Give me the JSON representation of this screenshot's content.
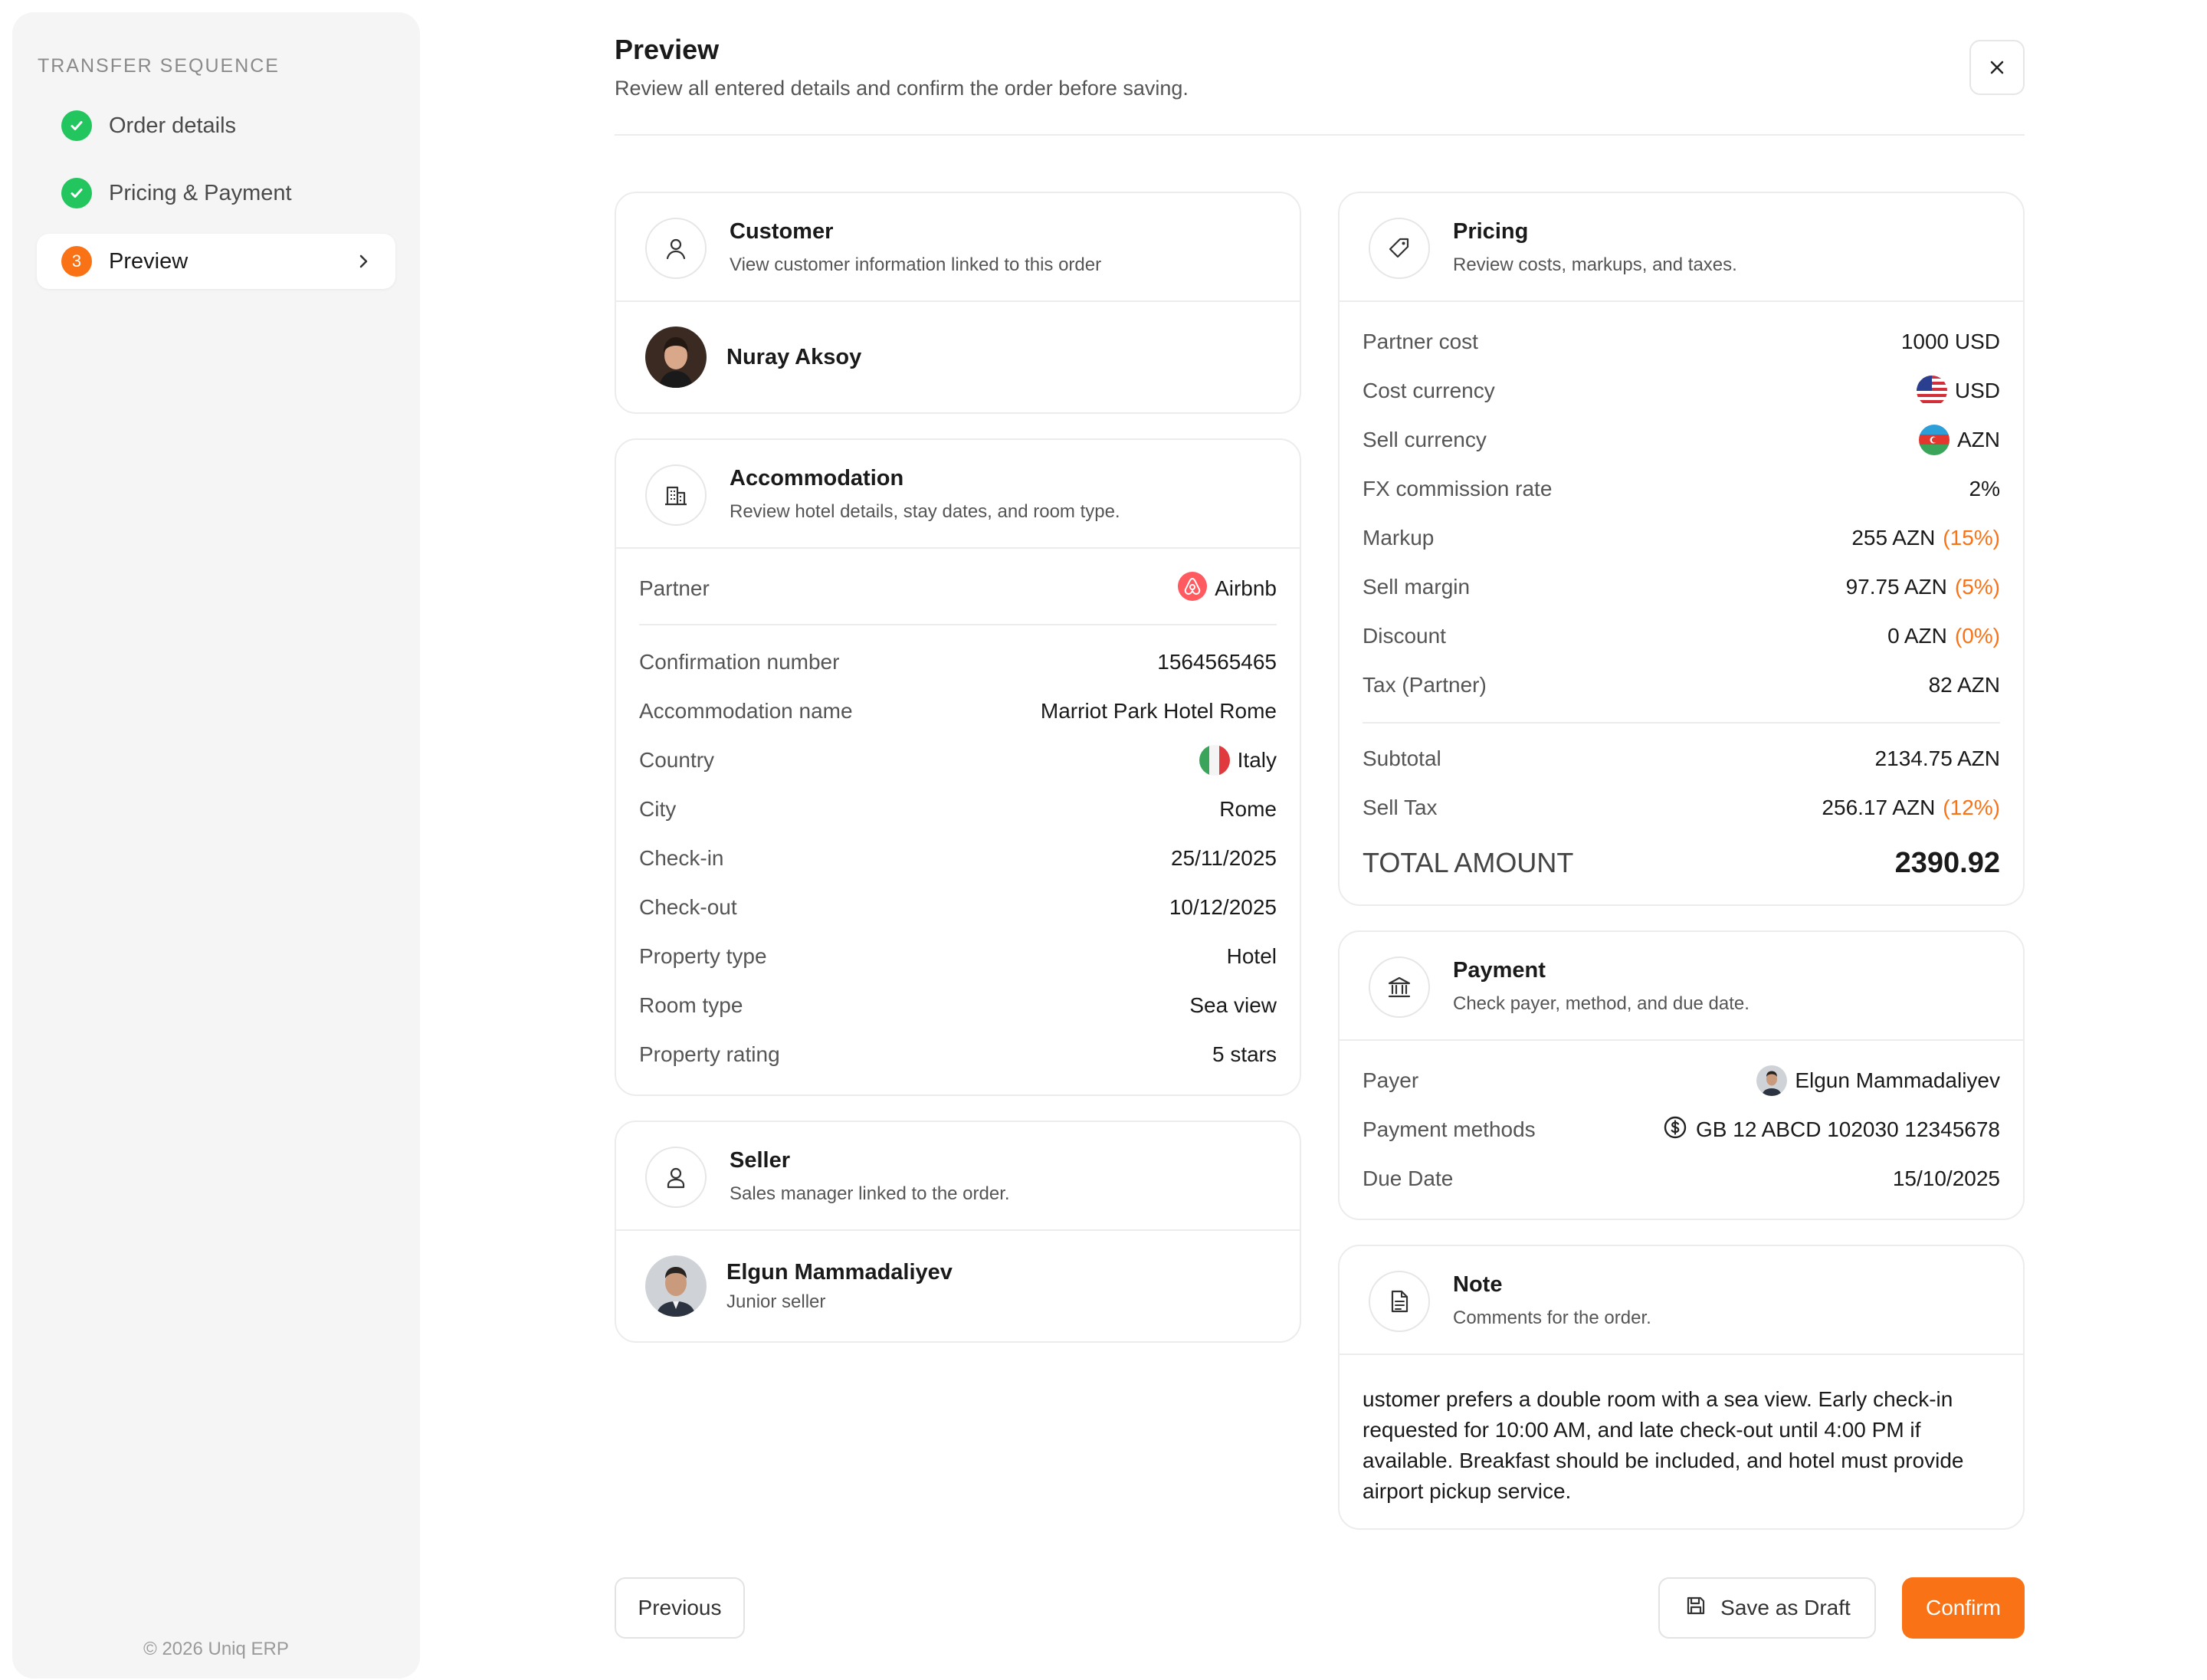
{
  "sidebar": {
    "title": "TRANSFER SEQUENCE",
    "steps": [
      {
        "label": "Order details",
        "state": "done"
      },
      {
        "label": "Pricing & Payment",
        "state": "done"
      },
      {
        "label": "Preview",
        "state": "current",
        "number": "3"
      }
    ],
    "copyright": "© 2026 Uniq ERP"
  },
  "header": {
    "title": "Preview",
    "subtitle": "Review all entered details and confirm the order before saving."
  },
  "customer": {
    "title": "Customer",
    "subtitle": "View customer information linked to this order",
    "name": "Nuray Aksoy"
  },
  "accommodation": {
    "title": "Accommodation",
    "subtitle": "Review hotel details, stay dates, and room type.",
    "partner_label": "Partner",
    "partner_value": "Airbnb",
    "rows": [
      {
        "label": "Confirmation number",
        "value": "1564565465"
      },
      {
        "label": "Accommodation name",
        "value": "Marriot Park Hotel Rome"
      },
      {
        "label": "Country",
        "value": "Italy"
      },
      {
        "label": "City",
        "value": "Rome"
      },
      {
        "label": "Check-in",
        "value": "25/11/2025"
      },
      {
        "label": "Check-out",
        "value": "10/12/2025"
      },
      {
        "label": "Property type",
        "value": "Hotel"
      },
      {
        "label": "Room type",
        "value": "Sea view"
      },
      {
        "label": "Property rating",
        "value": "5 stars"
      }
    ]
  },
  "seller": {
    "title": "Seller",
    "subtitle": "Sales manager linked to the order.",
    "name": "Elgun Mammadaliyev",
    "role": "Junior seller"
  },
  "pricing": {
    "title": "Pricing",
    "subtitle": "Review costs, markups, and taxes.",
    "rows": [
      {
        "label": "Partner cost",
        "value": "1000 USD",
        "extra": ""
      },
      {
        "label": "Cost currency",
        "value": "USD",
        "extra": ""
      },
      {
        "label": "Sell currency",
        "value": "AZN",
        "extra": ""
      },
      {
        "label": "FX commission rate",
        "value": "2%",
        "extra": ""
      },
      {
        "label": "Markup",
        "value": "255 AZN",
        "extra": "(15%)"
      },
      {
        "label": "Sell margin",
        "value": "97.75 AZN",
        "extra": "(5%)"
      },
      {
        "label": "Discount",
        "value": "0 AZN",
        "extra": "(0%)"
      },
      {
        "label": "Tax (Partner)",
        "value": "82 AZN",
        "extra": ""
      }
    ],
    "subtotal_label": "Subtotal",
    "subtotal_value": "2134.75 AZN",
    "sell_tax_label": "Sell Tax",
    "sell_tax_value": "256.17 AZN",
    "sell_tax_extra": "(12%)",
    "total_label": "TOTAL AMOUNT",
    "total_value": "2390.92"
  },
  "payment": {
    "title": "Payment",
    "subtitle": "Check payer, method, and due date.",
    "payer_label": "Payer",
    "payer_value": "Elgun Mammadaliyev",
    "methods_label": "Payment methods",
    "methods_value": "GB 12 ABCD 102030 12345678",
    "due_label": "Due Date",
    "due_value": "15/10/2025"
  },
  "note": {
    "title": "Note",
    "subtitle": "Comments for the order.",
    "text": "ustomer prefers a double room with a sea view. Early check-in requested for 10:00 AM, and late check-out until 4:00 PM if available. Breakfast should be included, and hotel must provide airport pickup service."
  },
  "footer": {
    "previous": "Previous",
    "save_draft": "Save as Draft",
    "confirm": "Confirm"
  },
  "colors": {
    "accent": "#f97316",
    "success": "#22c55e",
    "border": "#ececec"
  },
  "icons": [
    "check-icon",
    "chevron-right-icon",
    "close-icon",
    "user-icon",
    "building-icon",
    "seller-icon",
    "tag-icon",
    "bank-icon",
    "document-icon",
    "airbnb-logo-icon",
    "dollar-circle-icon",
    "save-icon"
  ]
}
